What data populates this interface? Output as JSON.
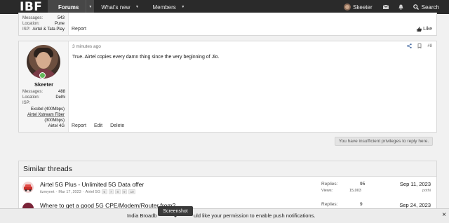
{
  "nav": {
    "logo": "IBF",
    "tabs": [
      {
        "label": "Forums",
        "active": true
      },
      {
        "label": "What's new"
      },
      {
        "label": "Members"
      }
    ],
    "username": "Skeeter",
    "search_label": "Search",
    "icons": [
      "envelope-icon",
      "bell-icon",
      "search-icon"
    ]
  },
  "post_prev": {
    "stats": [
      {
        "label": "Messages:",
        "value": "543"
      },
      {
        "label": "Location:",
        "value": "Pune"
      },
      {
        "label": "ISP:",
        "value": "Airtel & Tata Play"
      }
    ],
    "actions": [
      "Report"
    ],
    "like_label": "Like"
  },
  "post_main": {
    "time": "3 minutes ago",
    "number": "#8",
    "body": "True. Airtel copies every damn thing since the very beginning of Jio.",
    "author": "Skeeter",
    "stats": [
      {
        "label": "Messages:",
        "value": "488"
      },
      {
        "label": "Location:",
        "value": "Delhi"
      },
      {
        "label": "ISP:",
        "value": ""
      }
    ],
    "isp_lines": [
      "Excitel (400Mbps)",
      "Airtel Xstream Fiber",
      "(300Mbps)",
      "Airtel 4G"
    ],
    "actions": [
      "Report",
      "Edit",
      "Delete"
    ]
  },
  "no_reply_notice": "You have insufficient privileges to reply here.",
  "similar": {
    "heading": "Similar threads",
    "threads": [
      {
        "title": "Airtel 5G Plus - Unlimited 5G Data offer",
        "author": "itzmynet",
        "date": "Mar 17, 2023",
        "forum": "Airtel 5G",
        "pages": [
          "6",
          "7",
          "8",
          "9",
          "10"
        ],
        "replies_label": "Replies:",
        "replies": "95",
        "views_label": "Views:",
        "views": "15,003",
        "last_date": "Sep 11, 2023",
        "last_user": "pothi"
      },
      {
        "title": "Where to get a good 5G CPE/Modem/Router from?",
        "replies_label": "Replies:",
        "replies": "9",
        "last_date": "Sep 24, 2023"
      }
    ]
  },
  "push_bar": {
    "message_start": "India Broadb",
    "message_end": "uld like your permission to enable push notifications.",
    "close": "×"
  },
  "tooltip": "Screenshot"
}
